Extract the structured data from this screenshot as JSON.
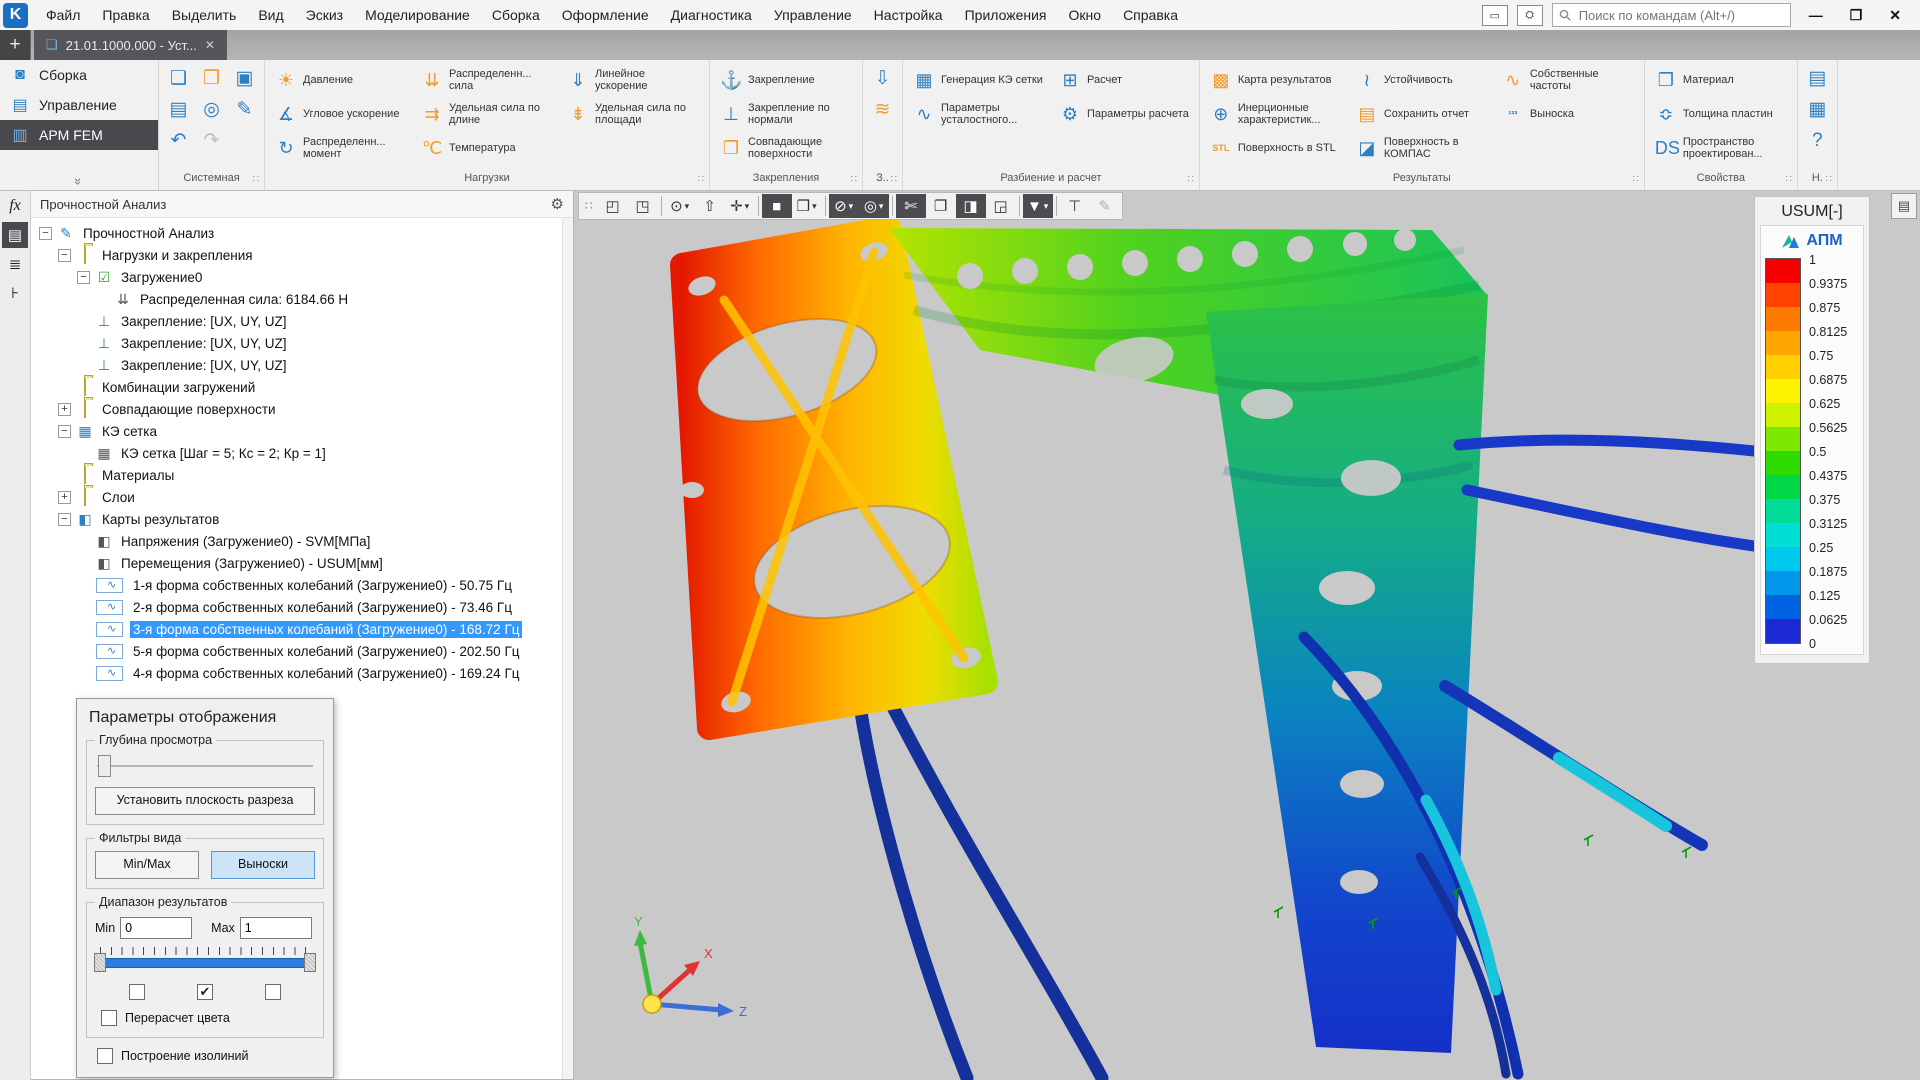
{
  "window": {
    "logo": "K",
    "menu_items": [
      "Файл",
      "Правка",
      "Выделить",
      "Вид",
      "Эскиз",
      "Моделирование",
      "Сборка",
      "Оформление",
      "Диагностика",
      "Управление",
      "Настройка",
      "Приложения",
      "Окно",
      "Справка"
    ],
    "search_placeholder": "Поиск по командам (Alt+/)",
    "new_tab": "+",
    "tab_title": "21.01.1000.000 - Уст...",
    "tab_close": "✕",
    "minimize": "—",
    "restore": "❐",
    "close": "✕"
  },
  "ribbon": {
    "modes": [
      {
        "label": "Сборка",
        "glyph": "◙",
        "name": "ribbon-mode-sborka"
      },
      {
        "label": "Управление",
        "glyph": "▤",
        "name": "ribbon-mode-upravlenie"
      },
      {
        "label": "APM FEM",
        "glyph": "▥",
        "name": "ribbon-mode-apm-fem"
      }
    ],
    "active_mode_index": 2,
    "groups": [
      {
        "label": "Системная",
        "columns": [
          [
            {
              "n": "new-file-button",
              "i": "new-file-icon",
              "g": "❏",
              "c": "b"
            },
            {
              "n": "print-button",
              "i": "print-icon",
              "g": "▤",
              "c": "b"
            },
            {
              "n": "undo-button",
              "i": "undo-icon",
              "g": "↶",
              "c": "b"
            }
          ],
          [
            {
              "n": "open-button",
              "i": "open-folder-icon",
              "g": "❒",
              "c": "o"
            },
            {
              "n": "print-preview-button",
              "i": "print-preview-icon",
              "g": "◎",
              "c": "b"
            },
            {
              "n": "redo-button",
              "i": "redo-icon",
              "g": "↷",
              "c": "g"
            }
          ],
          [
            {
              "n": "save-button",
              "i": "save-icon",
              "g": "▣",
              "c": "b"
            },
            {
              "n": "save-as-button",
              "i": "save-as-icon",
              "g": "✎",
              "c": "b"
            }
          ]
        ]
      },
      {
        "label": "Нагрузки",
        "columns": [
          [
            {
              "n": "pressure-button",
              "i": "pressure-icon",
              "g": "☀",
              "c": "o",
              "label": "Давление"
            },
            {
              "n": "angular-acceleration-button",
              "i": "angular-acceleration-icon",
              "g": "∡",
              "c": "b",
              "label": "Угловое ускорение"
            },
            {
              "n": "distributed-moment-button",
              "i": "distributed-moment-icon",
              "g": "↻",
              "c": "b",
              "label": "Распределенн... момент"
            }
          ],
          [
            {
              "n": "distributed-force-button",
              "i": "distributed-force-icon",
              "g": "⇊",
              "c": "o",
              "label": "Распределенн... сила"
            },
            {
              "n": "force-per-length-button",
              "i": "force-per-length-icon",
              "g": "⇉",
              "c": "o",
              "label": "Удельная сила по длине"
            },
            {
              "n": "temperature-button",
              "i": "temperature-icon",
              "g": "℃",
              "c": "o",
              "label": "Температура"
            }
          ],
          [
            {
              "n": "linear-acceleration-button",
              "i": "linear-acceleration-icon",
              "g": "⇓",
              "c": "b",
              "label": "Линейное ускорение"
            },
            {
              "n": "force-per-area-button",
              "i": "force-per-area-icon",
              "g": "⇟",
              "c": "o",
              "label": "Удельная сила по площади"
            }
          ]
        ]
      },
      {
        "label": "Закрепления",
        "columns": [
          [
            {
              "n": "fixture-button",
              "i": "fixture-icon",
              "g": "⚓",
              "c": "b",
              "label": "Закрепление"
            },
            {
              "n": "fixture-normal-button",
              "i": "fixture-normal-icon",
              "g": "⊥",
              "c": "b",
              "label": "Закрепление по нормали"
            },
            {
              "n": "coincident-surfaces-button",
              "i": "coincident-surfaces-icon",
              "g": "❐",
              "c": "o",
              "label": "Совпадающие поверхности"
            }
          ]
        ]
      },
      {
        "label": "З..",
        "columns": [
          [
            {
              "n": "load-transfer-button",
              "i": "load-transfer-icon",
              "g": "⇩",
              "c": "b"
            },
            {
              "n": "coincident-stack-button",
              "i": "coincident-stack-icon",
              "g": "≋",
              "c": "o"
            }
          ]
        ]
      },
      {
        "label": "Разбиение и расчет",
        "columns": [
          [
            {
              "n": "mesh-generation-button",
              "i": "mesh-generation-icon",
              "g": "▦",
              "c": "b",
              "label": "Генерация КЭ сетки"
            },
            {
              "n": "fatigue-parameters-button",
              "i": "fatigue-parameters-icon",
              "g": "∿",
              "c": "b",
              "label": "Параметры усталостного..."
            }
          ],
          [
            {
              "n": "calculate-button",
              "i": "calculate-icon",
              "g": "⊞",
              "c": "b",
              "label": "Расчет"
            },
            {
              "n": "calculation-parameters-button",
              "i": "calculation-parameters-icon",
              "g": "⚙",
              "c": "b",
              "label": "Параметры расчета"
            }
          ]
        ]
      },
      {
        "label": "Результаты",
        "columns": [
          [
            {
              "n": "result-map-button",
              "i": "result-map-icon",
              "g": "▩",
              "c": "o",
              "label": "Карта результатов"
            },
            {
              "n": "inertia-characteristics-button",
              "i": "inertia-characteristics-icon",
              "g": "⊕",
              "c": "b",
              "label": "Инерционные характеристик..."
            },
            {
              "n": "stl-surface-button",
              "i": "stl-surface-icon",
              "g": "STL",
              "c": "o",
              "label": "Поверхность в STL"
            }
          ],
          [
            {
              "n": "stability-button",
              "i": "stability-icon",
              "g": "≀",
              "c": "b",
              "label": "Устойчивость"
            },
            {
              "n": "save-report-button",
              "i": "save-report-icon",
              "g": "▤",
              "c": "o",
              "label": "Сохранить отчет"
            },
            {
              "n": "kompas-surface-button",
              "i": "kompas-surface-icon",
              "g": "◪",
              "c": "b",
              "label": "Поверхность в КОМПАС"
            }
          ],
          [
            {
              "n": "eigenfrequencies-button",
              "i": "eigenfrequencies-icon",
              "g": "∿",
              "c": "o",
              "label": "Собственные частоты"
            },
            {
              "n": "callout-button",
              "i": "callout-icon",
              "g": "¹²³",
              "c": "b",
              "label": "Выноска"
            }
          ]
        ]
      },
      {
        "label": "Свойства",
        "columns": [
          [
            {
              "n": "material-button",
              "i": "material-icon",
              "g": "❐",
              "c": "b",
              "label": "Материал"
            },
            {
              "n": "plate-thickness-button",
              "i": "plate-thickness-icon",
              "g": "≎",
              "c": "b",
              "label": "Толщина пластин"
            },
            {
              "n": "design-space-button",
              "i": "design-space-icon",
              "g": "DS",
              "c": "b",
              "label": "Пространство проектирован..."
            }
          ]
        ]
      },
      {
        "label": "Н.",
        "columns": [
          [
            {
              "n": "report-list-button",
              "i": "report-list-icon",
              "g": "▤",
              "c": "b"
            },
            {
              "n": "report-table-button",
              "i": "report-table-icon",
              "g": "▦",
              "c": "b"
            },
            {
              "n": "help-button",
              "i": "help-icon",
              "g": "?",
              "c": "b"
            }
          ]
        ]
      }
    ]
  },
  "left_strip": [
    {
      "name": "formula-panel-button",
      "icon": "fx-icon",
      "glyph": "fx",
      "cls": "fx"
    },
    {
      "name": "model-tree-button",
      "icon": "tree-list-icon",
      "glyph": "▤",
      "active": true
    },
    {
      "name": "sections-panel-button",
      "icon": "layers-icon",
      "glyph": "≣"
    },
    {
      "name": "structure-panel-button",
      "icon": "structure-icon",
      "glyph": "⊦"
    }
  ],
  "panel": {
    "header": "Прочностной Анализ",
    "gear": "⚙"
  },
  "tree": {
    "nodes": [
      {
        "l": 0,
        "e": "-",
        "g": "✎",
        "c": "b",
        "t": "Прочностной Анализ"
      },
      {
        "l": 1,
        "e": "-",
        "g": "folder",
        "t": "Нагрузки и закрепления"
      },
      {
        "l": 2,
        "e": "-",
        "g": "☑",
        "c": "grn",
        "t": "Загружение0"
      },
      {
        "l": 3,
        "e": "",
        "g": "⇊",
        "c": "d",
        "t": "Распределенная сила: 6184.66 Н"
      },
      {
        "l": 2,
        "e": "",
        "g": "⊥",
        "c": "b",
        "t": "Закрепление: [UX, UY, UZ]"
      },
      {
        "l": 2,
        "e": "",
        "g": "⊥",
        "c": "b",
        "t": "Закрепление: [UX, UY, UZ]"
      },
      {
        "l": 2,
        "e": "",
        "g": "⊥",
        "c": "b",
        "t": "Закрепление: [UX, UY, UZ]"
      },
      {
        "l": 1,
        "e": "",
        "g": "folder",
        "t": "Комбинации загружений"
      },
      {
        "l": 1,
        "e": "+",
        "g": "folder",
        "t": "Совпадающие поверхности"
      },
      {
        "l": 1,
        "e": "-",
        "g": "▦",
        "c": "b",
        "t": "КЭ сетка"
      },
      {
        "l": 2,
        "e": "",
        "g": "▦",
        "c": "d",
        "t": "КЭ сетка [Шаг = 5; Кс = 2; Кр = 1]"
      },
      {
        "l": 1,
        "e": "",
        "g": "folder",
        "t": "Материалы"
      },
      {
        "l": 1,
        "e": "+",
        "g": "folder",
        "t": "Слои"
      },
      {
        "l": 1,
        "e": "-",
        "g": "◧",
        "c": "b",
        "t": "Карты результатов"
      },
      {
        "l": 2,
        "e": "",
        "g": "◧",
        "c": "d",
        "t": "Напряжения (Загружение0) - SVM[МПа]"
      },
      {
        "l": 2,
        "e": "",
        "g": "◧",
        "c": "d",
        "t": "Перемещения (Загружение0) - USUM[мм]"
      },
      {
        "l": 2,
        "e": "",
        "g": "∿",
        "c": "mode",
        "t": "1-я форма собственных колебаний (Загружение0) - 50.75 Гц"
      },
      {
        "l": 2,
        "e": "",
        "g": "∿",
        "c": "mode",
        "t": "2-я форма собственных колебаний (Загружение0) - 73.46 Гц"
      },
      {
        "l": 2,
        "e": "",
        "g": "∿",
        "c": "mode",
        "t": "3-я форма собственных колебаний (Загружение0) - 168.72 Гц",
        "sel": true
      },
      {
        "l": 2,
        "e": "",
        "g": "∿",
        "c": "mode",
        "t": "5-я форма собственных колебаний (Загружение0) - 202.50 Гц"
      },
      {
        "l": 2,
        "e": "",
        "g": "∿",
        "c": "mode",
        "t": "4-я форма собственных колебаний (Загружение0) - 169.24 Гц"
      }
    ]
  },
  "display_params": {
    "title": "Параметры отображения",
    "depth": {
      "label": "Глубина просмотра"
    },
    "set_plane_button": "Установить плоскость разреза",
    "filters": {
      "label": "Фильтры вида",
      "minmax": "Min/Max",
      "callouts": "Выноски"
    },
    "range": {
      "label": "Диапазон результатов",
      "min_label": "Min",
      "min_value": "0",
      "max_label": "Max",
      "max_value": "1",
      "checkboxes": [
        false,
        true,
        false
      ],
      "check_glyph": "✔"
    },
    "recalc_colors": "Перерасчет цвета",
    "isolines": "Построение изолиний"
  },
  "viewport": {
    "toolbar": [
      {
        "g": "∷",
        "n": "toolbar-grip-icon",
        "grip": true
      },
      {
        "g": "◰",
        "n": "show-all-button"
      },
      {
        "g": "◳",
        "n": "orientation-button"
      },
      {
        "sep": true
      },
      {
        "g": "⊙",
        "n": "zoom-button",
        "dd": true
      },
      {
        "g": "⇧",
        "n": "pan-button"
      },
      {
        "g": "✛",
        "n": "move-component-button",
        "dd": true
      },
      {
        "sep": true
      },
      {
        "g": "■",
        "n": "shaded-display-button",
        "active": true
      },
      {
        "g": "❒",
        "n": "wireframe-display-button",
        "dd": true
      },
      {
        "sep": true
      },
      {
        "g": "⊘",
        "n": "hide-objects-button",
        "active": true,
        "dd": true
      },
      {
        "g": "◎",
        "n": "ghost-display-button",
        "active": true,
        "dd": true
      },
      {
        "sep": true
      },
      {
        "g": "✄",
        "n": "section-view-button",
        "active": true
      },
      {
        "g": "❐",
        "n": "copy-properties-button"
      },
      {
        "g": "◨",
        "n": "cutaway-button",
        "active": true
      },
      {
        "g": "◲",
        "n": "local-section-button"
      },
      {
        "sep": true
      },
      {
        "g": "▼",
        "n": "filter-button",
        "active": true,
        "dd": true
      },
      {
        "sep": true
      },
      {
        "g": "⊤",
        "n": "measure-button"
      },
      {
        "g": "✎",
        "n": "probe-button",
        "disabled": true
      }
    ],
    "triad": {
      "x": "X",
      "y": "Y",
      "z": "Z"
    }
  },
  "legend": {
    "title": "USUM[-]",
    "brand": "АПМ",
    "values": [
      "1",
      "0.9375",
      "0.875",
      "0.8125",
      "0.75",
      "0.6875",
      "0.625",
      "0.5625",
      "0.5",
      "0.4375",
      "0.375",
      "0.3125",
      "0.25",
      "0.1875",
      "0.125",
      "0.0625",
      "0"
    ],
    "colors": [
      "#f60000",
      "#ff4300",
      "#ff7a00",
      "#ffa700",
      "#ffd000",
      "#fef400",
      "#cef200",
      "#7de700",
      "#2edb00",
      "#00d747",
      "#00dc97",
      "#00dfd3",
      "#00c7ee",
      "#0096ea",
      "#0063e2",
      "#1c2ad6"
    ]
  },
  "side_icon": "▤"
}
